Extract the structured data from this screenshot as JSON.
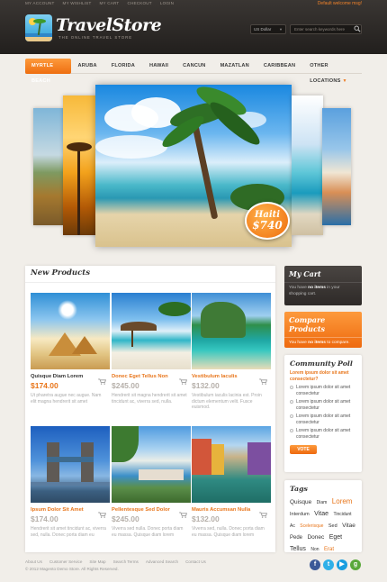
{
  "header": {
    "top_links": [
      "MY ACCOUNT",
      "MY WISHLIST",
      "MY CART",
      "CHECKOUT",
      "LOGIN"
    ],
    "welcome": "Default welcome msg!",
    "logo_title": "TravelStore",
    "logo_subtitle": "THE ONLINE TRAVEL STORE",
    "currency": "US Dollar",
    "search_placeholder": "Enter search keywords here"
  },
  "nav": {
    "items": [
      "MYRTLE BEACH",
      "ARUBA",
      "FLORIDA",
      "HAWAII",
      "CANCUN",
      "MAZATLAN",
      "CARIBBEAN",
      "OTHER LOCATIONS"
    ],
    "active_index": 0
  },
  "slider": {
    "badge_place": "Haiti",
    "badge_price": "$740"
  },
  "products": {
    "title": "New Products",
    "items": [
      {
        "name": "Quisque Diam Lorem",
        "price": "$174.00",
        "desc": "Ut pharetra augue nec augue. Nam elit magna hendrerit sit amet",
        "price_style": "orange",
        "image": "pyramids"
      },
      {
        "name": "Donec Eget Tellus Non",
        "price": "$245.00",
        "desc": "Hendrerit sit magna hendrerit sit amet tincidunt ac, viverra sed, nulla.",
        "price_style": "grey",
        "image": "beach-hut"
      },
      {
        "name": "Vestibulum Iaculis",
        "price": "$132.00",
        "desc": "Vestibulum iaculis lacinia est. Proin dictum elementum velit. Fusce euismod.",
        "price_style": "grey",
        "image": "tropical-cove"
      },
      {
        "name": "Ipsum Dolor Sit Amet",
        "price": "$174.00",
        "desc": "Hendrerit sit amet tincidunt ac, viverra sed, nulla. Donec porta diam eu",
        "price_style": "grey",
        "image": "tower-bridge"
      },
      {
        "name": "Pellentesque Sed Dolor",
        "price": "$245.00",
        "desc": "Viverra sed nulla. Donec porta diam eu massa. Quisque diam lorem",
        "price_style": "grey",
        "image": "coastal-town"
      },
      {
        "name": "Mauris Accumsan Nulla",
        "price": "$132.00",
        "desc": "Viverra sed, nulla. Donec porta diam eu massa. Quisque diam lorem",
        "price_style": "grey",
        "image": "canal-houses"
      }
    ]
  },
  "sidebar": {
    "cart": {
      "title": "My Cart",
      "text_pre": "You have ",
      "text_bold": "no items",
      "text_post": " in your shopping cart."
    },
    "compare": {
      "title": "Compare Products",
      "text_pre": "You have ",
      "text_bold": "no items",
      "text_post": " to compare."
    },
    "poll": {
      "title": "Community Poll",
      "question": "Lorem ipsum dolor sit amet consectetur?",
      "options": [
        "Lorem ipsum dolor sit amet consectetur",
        "Lorem ipsum dolor sit amet consectetur",
        "Lorem ipsum dolor sit amet consectetur",
        "Lorem ipsum dolor sit amet consectetur"
      ],
      "vote_label": "VOTE"
    },
    "tags": {
      "title": "Tags",
      "items": [
        {
          "text": "Quisque",
          "size": 6.5,
          "orange": false
        },
        {
          "text": "Diam",
          "size": 5,
          "orange": false
        },
        {
          "text": "Lorem",
          "size": 8,
          "orange": true
        },
        {
          "text": "Interdum",
          "size": 5.5,
          "orange": false
        },
        {
          "text": "Vitae",
          "size": 7,
          "orange": false
        },
        {
          "text": "Tincidunt",
          "size": 5,
          "orange": false
        },
        {
          "text": "Ac",
          "size": 5,
          "orange": false
        },
        {
          "text": "Scelerisque",
          "size": 5,
          "orange": true
        },
        {
          "text": "Sed",
          "size": 5.5,
          "orange": false
        },
        {
          "text": "Vitae",
          "size": 6.5,
          "orange": false
        },
        {
          "text": "Pede",
          "size": 6,
          "orange": false
        },
        {
          "text": "Donec",
          "size": 6.5,
          "orange": false
        },
        {
          "text": "Eget",
          "size": 7,
          "orange": false
        },
        {
          "text": "Tellus",
          "size": 7,
          "orange": false
        },
        {
          "text": "Non",
          "size": 5,
          "orange": false
        },
        {
          "text": "Erat",
          "size": 6,
          "orange": true
        }
      ]
    }
  },
  "footer": {
    "links": [
      "About Us",
      "Customer Service",
      "Site Map",
      "Search Terms",
      "Advanced Search",
      "Contact Us"
    ],
    "copyright": "© 2012 Magento Demo Store. All Rights Reserved.",
    "social": [
      {
        "name": "facebook-icon",
        "glyph": "f",
        "color": "#3b5998"
      },
      {
        "name": "twitter-icon",
        "glyph": "t",
        "color": "#2fb0e8"
      },
      {
        "name": "youtube-icon",
        "glyph": "▶",
        "color": "#1a9ee0"
      },
      {
        "name": "google-icon",
        "glyph": "g",
        "color": "#5aa83a"
      }
    ]
  }
}
